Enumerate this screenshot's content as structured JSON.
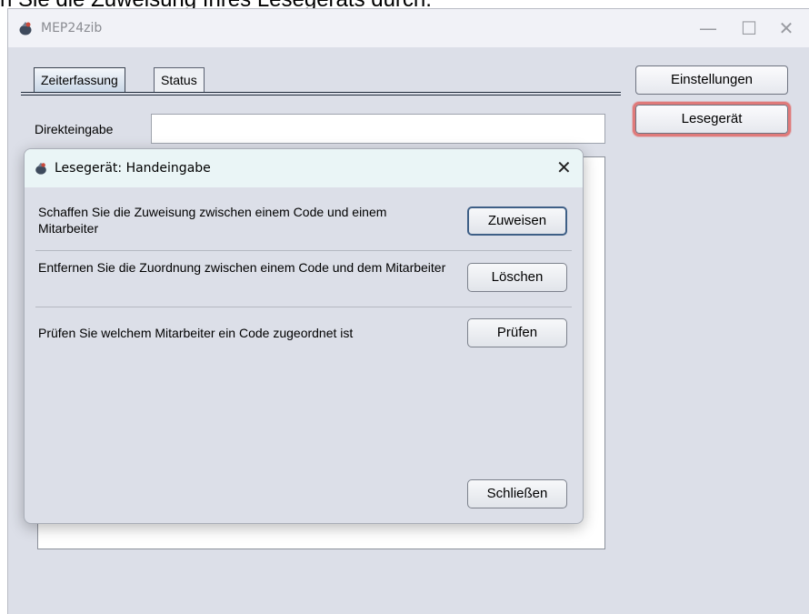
{
  "top_caption": "n Sie die Zuweisung Ihres Lesegeräts durch.",
  "window": {
    "title": "MEP24zib",
    "minimize_glyph": "—",
    "maximize_glyph": "☐",
    "close_glyph": "✕",
    "icon": "app-icon"
  },
  "tabs": [
    {
      "label": "Zeiterfassung",
      "active": true
    },
    {
      "label": "Status",
      "active": false
    }
  ],
  "direct_input": {
    "label": "Direkteingabe",
    "value": ""
  },
  "side_buttons": {
    "settings": "Einstellungen",
    "reader": "Lesegerät"
  },
  "dialog": {
    "title": "Lesegerät: Handeingabe",
    "close_glyph": "✕",
    "rows": [
      {
        "text": "Schaffen Sie die Zuweisung zwischen einem Code und einem Mitarbeiter",
        "button": "Zuweisen"
      },
      {
        "text": "Entfernen Sie die Zuordnung zwischen einem Code und dem Mitarbeiter",
        "button": "Löschen"
      },
      {
        "text": "Prüfen Sie welchem Mitarbeiter ein Code zugeordnet ist",
        "button": "Prüfen"
      }
    ],
    "close_button": "Schließen"
  },
  "colors": {
    "window_bg": "#dcdfe8",
    "highlight": "#e07a7a",
    "focus_border": "#3e5f86"
  }
}
